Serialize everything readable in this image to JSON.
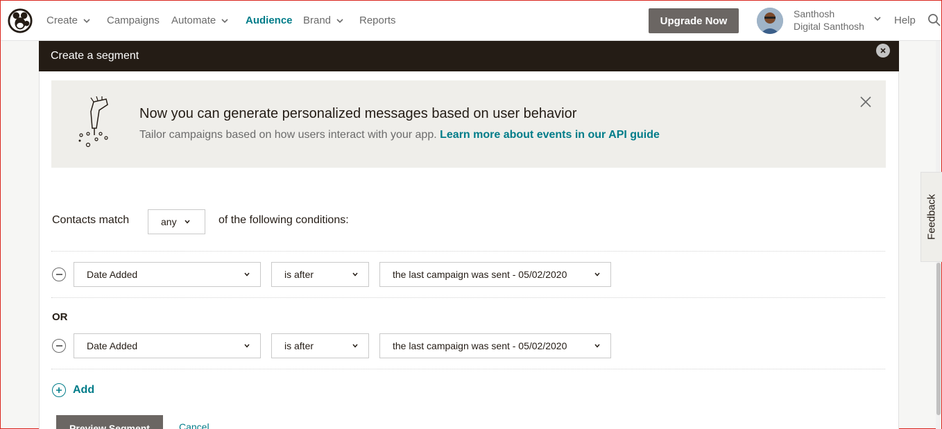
{
  "nav": {
    "items": [
      {
        "label": "Create",
        "has_dropdown": true,
        "active": false
      },
      {
        "label": "Campaigns",
        "has_dropdown": false,
        "active": false
      },
      {
        "label": "Automate",
        "has_dropdown": true,
        "active": false
      },
      {
        "label": "Audience",
        "has_dropdown": false,
        "active": true
      },
      {
        "label": "Brand",
        "has_dropdown": true,
        "active": false
      },
      {
        "label": "Reports",
        "has_dropdown": false,
        "active": false
      }
    ],
    "upgrade_label": "Upgrade Now",
    "user": {
      "name": "Santhosh",
      "account": "Digital Santhosh"
    },
    "help_label": "Help"
  },
  "modal": {
    "title": "Create a segment"
  },
  "banner": {
    "title": "Now you can generate personalized messages based on user behavior",
    "text": "Tailor campaigns based on how users interact with your app.",
    "link": "Learn more about events in our API guide"
  },
  "match": {
    "prefix": "Contacts match",
    "value": "any",
    "suffix": "of the following conditions:"
  },
  "conditions": [
    {
      "field": "Date Added",
      "operator": "is after",
      "value": "the last campaign was sent - 05/02/2020"
    },
    {
      "field": "Date Added",
      "operator": "is after",
      "value": "the last campaign was sent - 05/02/2020"
    }
  ],
  "or_label": "OR",
  "add_label": "Add",
  "preview_label": "Preview Segment",
  "cancel_label": "Cancel",
  "feedback_label": "Feedback",
  "colors": {
    "accent": "#007c89",
    "header_dark": "#241c15",
    "button_gray": "#6b6663",
    "banner_bg": "#efeeea"
  }
}
